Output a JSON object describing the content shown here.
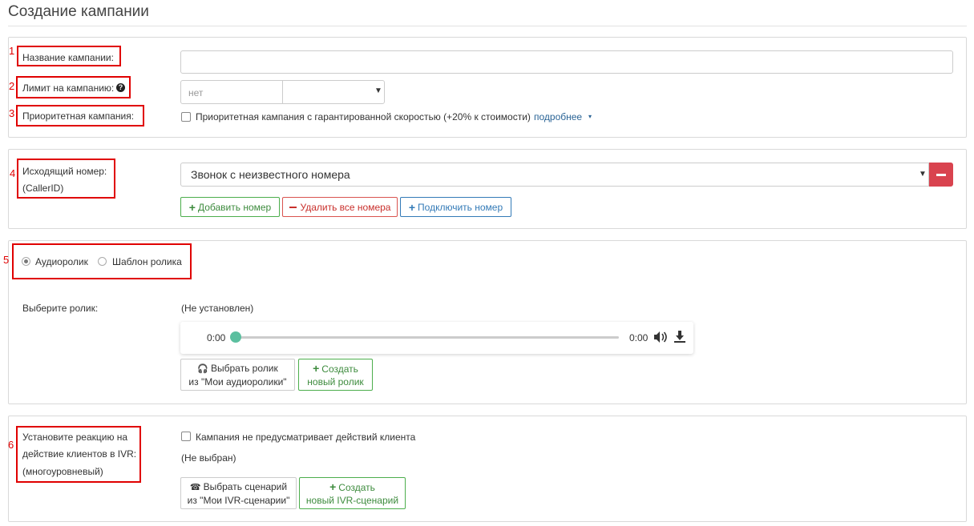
{
  "page": {
    "title": "Создание кампании"
  },
  "annotations": [
    "1",
    "2",
    "3",
    "4",
    "5",
    "6"
  ],
  "campaign_name": {
    "label": "Название кампании:",
    "value": ""
  },
  "limit": {
    "label": "Лимит на кампанию:",
    "placeholder": "нет",
    "select_value": "",
    "help_icon": "question-circle-icon"
  },
  "priority": {
    "label": "Приоритетная кампания:",
    "checkbox_label": "Приоритетная кампания с гарантированной скоростью (+20% к стоимости)",
    "more_link": "подробнее",
    "more_arrow": "▾"
  },
  "caller_id": {
    "label_line1": "Исходящий номер:",
    "label_line2": "(CallerID)",
    "selected": "Звонок с неизвестного номера",
    "remove_icon": "minus",
    "add_button": "Добавить номер",
    "delete_all_button": "Удалить все номера",
    "connect_button": "Подключить номер"
  },
  "audio": {
    "radio_audio": "Аудиоролик",
    "radio_template": "Шаблон ролика",
    "select_label": "Выберите ролик:",
    "status": "(Не установлен)",
    "player": {
      "current_time": "0:00",
      "duration": "0:00",
      "progress": 0
    },
    "choose_button_line1": "Выбрать ролик",
    "choose_button_line2": "из \"Мои аудиоролики\"",
    "create_button_line1": "Создать",
    "create_button_line2": "новый ролик"
  },
  "ivr": {
    "label_line1": "Установите реакцию на",
    "label_line2": "действие клиентов в IVR:",
    "label_line3": "(многоуровневый)",
    "checkbox_label": "Кампания не предусматривает действий клиента",
    "status": "(Не выбран)",
    "choose_button_line1": "Выбрать сценарий",
    "choose_button_line2": "из \"Мои IVR-сценарии\"",
    "create_button_line1": "Создать",
    "create_button_line2": "новый IVR-сценарий"
  },
  "colors": {
    "annotation": "#e00000",
    "primary": "#337ab7",
    "success": "#4cae4c",
    "danger": "#d9534f",
    "player_thumb": "#5bbf9f"
  }
}
